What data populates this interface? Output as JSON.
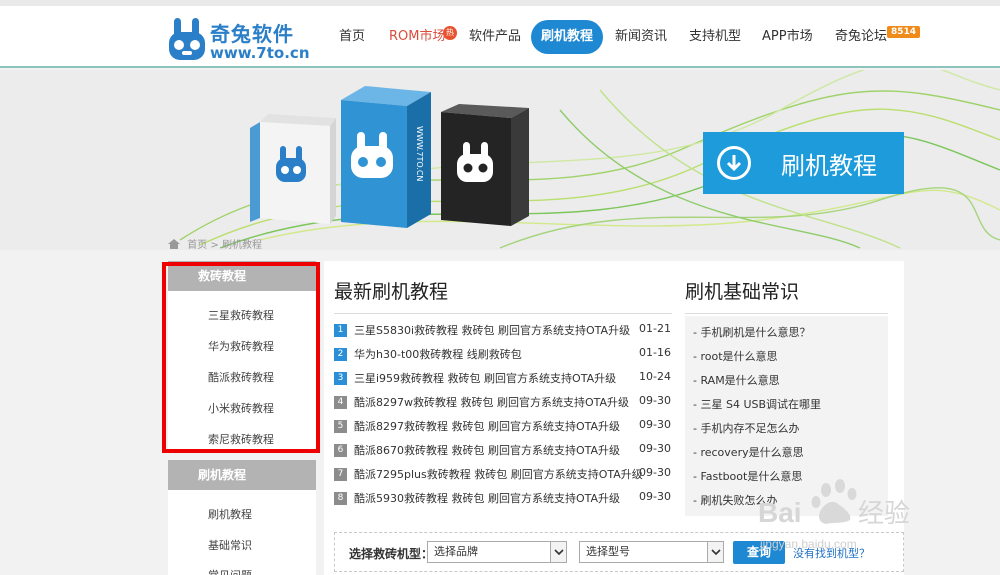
{
  "header": {
    "logo_name": "奇兔软件",
    "logo_url": "www.7to.cn",
    "nav": [
      {
        "label": "首页"
      },
      {
        "label": "ROM市场",
        "badge": "热"
      },
      {
        "label": "软件产品"
      },
      {
        "label": "刷机教程",
        "active": true
      },
      {
        "label": "新闻资讯"
      },
      {
        "label": "支持机型"
      },
      {
        "label": "APP市场"
      },
      {
        "label": "奇兔论坛",
        "badge": "8514"
      }
    ]
  },
  "banner": {
    "title": "刷机教程",
    "box_text": "WWW.7TO.CN"
  },
  "breadcrumb": {
    "home": "首页",
    "sep": ">",
    "current": "刷机教程"
  },
  "sidebar": {
    "groups": [
      {
        "title": "救砖教程",
        "items": [
          "三星救砖教程",
          "华为救砖教程",
          "酷派救砖教程",
          "小米救砖教程",
          "索尼救砖教程"
        ]
      },
      {
        "title": "刷机教程",
        "items": [
          "刷机教程",
          "基础常识",
          "常见问题"
        ]
      }
    ]
  },
  "latest": {
    "title": "最新刷机教程",
    "items": [
      {
        "num": "1",
        "title": "三星S5830i救砖教程 救砖包 刷回官方系统支持OTA升级",
        "date": "01-21"
      },
      {
        "num": "2",
        "title": "华为h30-t00救砖教程 线刷救砖包",
        "date": "01-16"
      },
      {
        "num": "3",
        "title": "三星i959救砖教程 救砖包 刷回官方系统支持OTA升级",
        "date": "10-24"
      },
      {
        "num": "4",
        "title": "酷派8297w救砖教程 救砖包 刷回官方系统支持OTA升级",
        "date": "09-30"
      },
      {
        "num": "5",
        "title": "酷派8297救砖教程 救砖包 刷回官方系统支持OTA升级",
        "date": "09-30"
      },
      {
        "num": "6",
        "title": "酷派8670救砖教程 救砖包 刷回官方系统支持OTA升级",
        "date": "09-30"
      },
      {
        "num": "7",
        "title": "酷派7295plus救砖教程 救砖包 刷回官方系统支持OTA升级",
        "date": "09-30"
      },
      {
        "num": "8",
        "title": "酷派5930救砖教程 救砖包 刷回官方系统支持OTA升级",
        "date": "09-30"
      }
    ]
  },
  "knowledge": {
    "title": "刷机基础常识",
    "items": [
      "- 手机刷机是什么意思？",
      "- root是什么意思",
      "- RAM是什么意思",
      "- 三星 S4 USB调试在哪里",
      "- 手机内存不足怎么办",
      "- recovery是什么意思",
      "- Fastboot是什么意思",
      "- 刷机失败怎么办"
    ]
  },
  "search": {
    "label": "选择救砖机型：",
    "brand_placeholder": "选择品牌",
    "model_placeholder": "选择型号",
    "button": "查询",
    "not_found": "没有找到机型？"
  },
  "watermark": {
    "brand": "Bai",
    "brand2": "经验",
    "url": "jingyan.baidu.com"
  },
  "colors": {
    "accent": "#1e88d2",
    "number_blue": "#2a8fd6",
    "number_gray": "#8c8c8c",
    "highlight_frame": "#e00000"
  }
}
